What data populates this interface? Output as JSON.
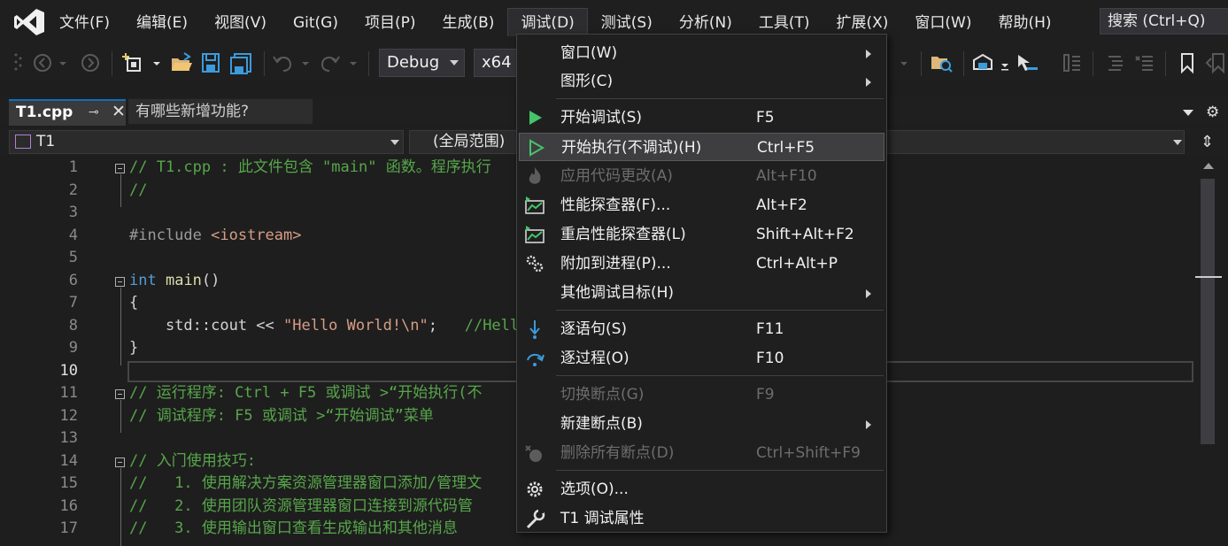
{
  "menubar": {
    "items": [
      "文件(F)",
      "编辑(E)",
      "视图(V)",
      "Git(G)",
      "项目(P)",
      "生成(B)",
      "调试(D)",
      "测试(S)",
      "分析(N)",
      "工具(T)",
      "扩展(X)",
      "窗口(W)",
      "帮助(H)"
    ],
    "open_index": 6,
    "search": "搜索 (Ctrl+Q)"
  },
  "toolbar": {
    "config": "Debug",
    "platform": "x64"
  },
  "tabs": {
    "active": "T1.cpp",
    "inactive": "有哪些新增功能?"
  },
  "navbar": {
    "scope": "T1",
    "member": "(全局范围)"
  },
  "editor": {
    "current_line": 10,
    "lines": [
      {
        "n": "1",
        "text": "// T1.cpp : 此文件包含 \"main\" 函数。程序执行"
      },
      {
        "n": "2",
        "text": "//"
      },
      {
        "n": "3",
        "text": ""
      },
      {
        "n": "4",
        "text": "#include <iostream>"
      },
      {
        "n": "5",
        "text": ""
      },
      {
        "n": "6",
        "text": "int main()"
      },
      {
        "n": "7",
        "text": "{"
      },
      {
        "n": "8",
        "text": "    std::cout << \"Hello World!\\n\";   //Hello"
      },
      {
        "n": "9",
        "text": "}"
      },
      {
        "n": "10",
        "text": ""
      },
      {
        "n": "11",
        "text": "// 运行程序: Ctrl + F5 或调试 >“开始执行(不"
      },
      {
        "n": "12",
        "text": "// 调试程序: F5 或调试 >“开始调试”菜单"
      },
      {
        "n": "13",
        "text": ""
      },
      {
        "n": "14",
        "text": "// 入门使用技巧:"
      },
      {
        "n": "15",
        "text": "//   1. 使用解决方案资源管理器窗口添加/管理文"
      },
      {
        "n": "16",
        "text": "//   2. 使用团队资源管理器窗口连接到源代码管"
      },
      {
        "n": "17",
        "text": "//   3. 使用输出窗口查看生成输出和其他消息"
      }
    ]
  },
  "debug_menu": {
    "items": [
      {
        "label": "窗口(W)",
        "shortcut": "",
        "icon": "",
        "submenu": true,
        "disabled": false
      },
      {
        "label": "图形(C)",
        "shortcut": "",
        "icon": "",
        "submenu": true,
        "disabled": false
      },
      {
        "label": "开始调试(S)",
        "shortcut": "F5",
        "icon": "play-icon",
        "submenu": false,
        "disabled": false
      },
      {
        "label": "开始执行(不调试)(H)",
        "shortcut": "Ctrl+F5",
        "icon": "play-outline-icon",
        "submenu": false,
        "disabled": false
      },
      {
        "label": "应用代码更改(A)",
        "shortcut": "Alt+F10",
        "icon": "flame-icon",
        "submenu": false,
        "disabled": true
      },
      {
        "label": "性能探查器(F)...",
        "shortcut": "Alt+F2",
        "icon": "profiler-icon",
        "submenu": false,
        "disabled": false
      },
      {
        "label": "重启性能探查器(L)",
        "shortcut": "Shift+Alt+F2",
        "icon": "profiler-restart-icon",
        "submenu": false,
        "disabled": false
      },
      {
        "label": "附加到进程(P)...",
        "shortcut": "Ctrl+Alt+P",
        "icon": "gears-icon",
        "submenu": false,
        "disabled": false
      },
      {
        "label": "其他调试目标(H)",
        "shortcut": "",
        "icon": "",
        "submenu": true,
        "disabled": false
      },
      {
        "label": "逐语句(S)",
        "shortcut": "F11",
        "icon": "step-into-icon",
        "submenu": false,
        "disabled": false
      },
      {
        "label": "逐过程(O)",
        "shortcut": "F10",
        "icon": "step-over-icon",
        "submenu": false,
        "disabled": false
      },
      {
        "label": "切换断点(G)",
        "shortcut": "F9",
        "icon": "",
        "submenu": false,
        "disabled": true
      },
      {
        "label": "新建断点(B)",
        "shortcut": "",
        "icon": "",
        "submenu": true,
        "disabled": false
      },
      {
        "label": "删除所有断点(D)",
        "shortcut": "Ctrl+Shift+F9",
        "icon": "delete-breakpoints-icon",
        "submenu": false,
        "disabled": true
      },
      {
        "label": "选项(O)...",
        "shortcut": "",
        "icon": "gear-icon",
        "submenu": false,
        "disabled": false
      },
      {
        "label": "T1 调试属性",
        "shortcut": "",
        "icon": "wrench-icon",
        "submenu": false,
        "disabled": false
      }
    ]
  }
}
